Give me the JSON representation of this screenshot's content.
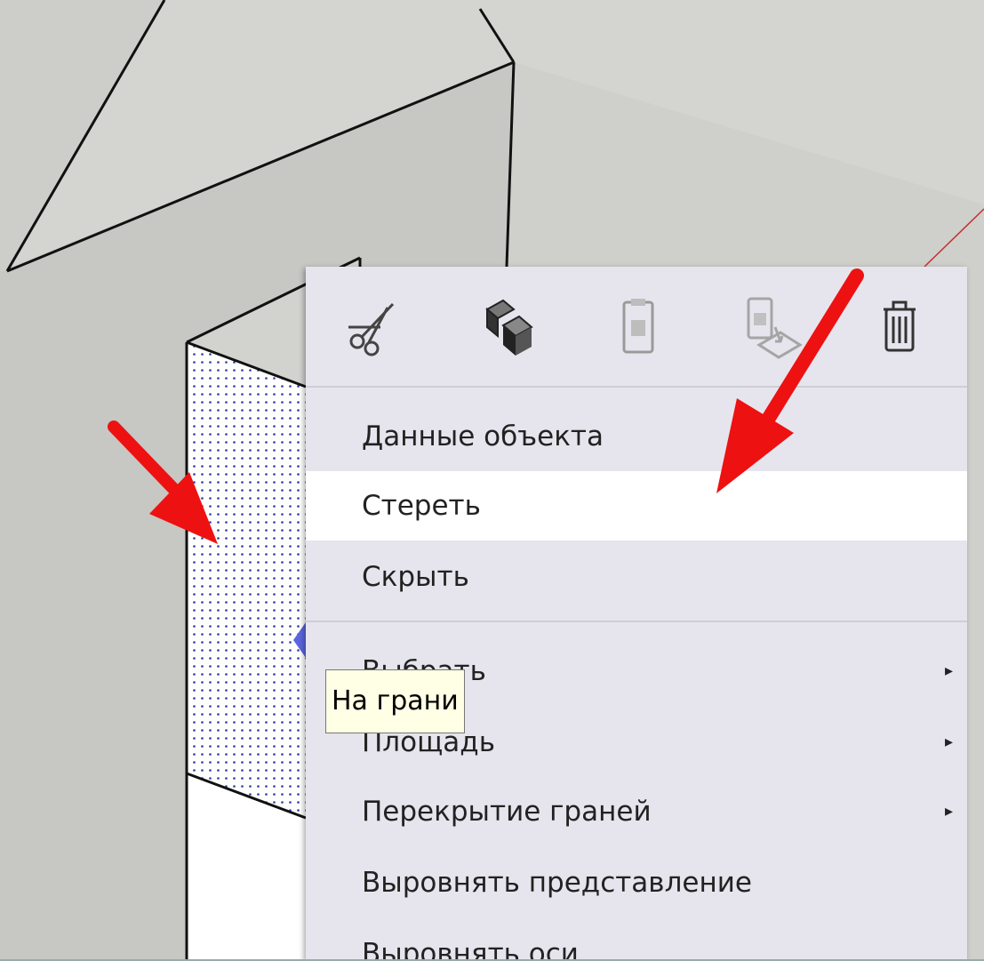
{
  "toolbar": {
    "tools": [
      {
        "icon": "scissors-icon",
        "name": "cut-button"
      },
      {
        "icon": "copy-icon",
        "name": "copy-button"
      },
      {
        "icon": "paste-icon",
        "name": "paste-button"
      },
      {
        "icon": "paste-in-place-icon",
        "name": "paste-in-place-button"
      },
      {
        "icon": "trash-icon",
        "name": "delete-button"
      }
    ]
  },
  "menu": {
    "entity_info": "Данные объекта",
    "erase": "Стереть",
    "hide": "Скрыть",
    "select": "Выбрать",
    "area": "Площадь",
    "intersect_faces": "Перекрытие граней",
    "align_view": "Выровнять представление",
    "align_axes": "Выровнять оси",
    "submenu_arrow": "▸"
  },
  "tooltip": {
    "text": "На грани"
  },
  "colors": {
    "menu_bg": "#e6e5ee",
    "highlight": "#ffffff",
    "annotation_arrow": "#ee1111",
    "face_dots": "#2a3b9a",
    "viewport_bg": "#cfcfcb"
  }
}
